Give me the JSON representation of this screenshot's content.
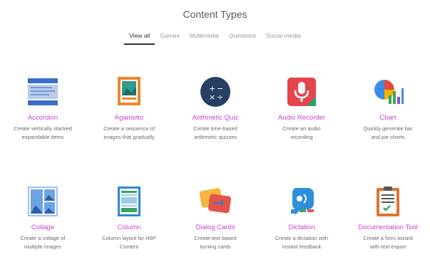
{
  "header": {
    "title": "Content Types"
  },
  "tabs": [
    {
      "label": "View all",
      "active": true
    },
    {
      "label": "Games"
    },
    {
      "label": "Multimedia"
    },
    {
      "label": "Questions"
    },
    {
      "label": "Social media"
    }
  ],
  "cards": [
    {
      "title": "Accordion",
      "desc1": "Create vertically stacked",
      "desc2": "expandable items",
      "icon": "accordion-icon"
    },
    {
      "title": "Agamotto",
      "desc1": "Create a sequence of",
      "desc2": "images that gradually",
      "icon": "agamotto-icon"
    },
    {
      "title": "Arithmetic Quiz",
      "desc1": "Create time-based",
      "desc2": "arithmetic quizzes",
      "icon": "arithmetic-quiz-icon"
    },
    {
      "title": "Audio Recorder",
      "desc1": "Create an audio",
      "desc2": "recording",
      "icon": "microphone-icon"
    },
    {
      "title": "Chart",
      "desc1": "Quickly generate bar",
      "desc2": "and pie charts",
      "icon": "chart-icon"
    },
    {
      "title": "Collage",
      "desc1": "Create a collage of",
      "desc2": "multiple images",
      "icon": "collage-icon"
    },
    {
      "title": "Column",
      "desc1": "Column layout for H5P",
      "desc2": "Content",
      "icon": "column-icon"
    },
    {
      "title": "Dialog Cards",
      "desc1": "Create text-based",
      "desc2": "turning cards",
      "icon": "dialog-cards-icon"
    },
    {
      "title": "Dictation",
      "desc1": "Create a dictation with",
      "desc2": "instant feedback",
      "icon": "dictation-icon"
    },
    {
      "title": "Documentation Tool",
      "desc1": "Create a form wizard",
      "desc2": "with text export",
      "icon": "documentation-tool-icon"
    }
  ],
  "colors": {
    "accent": "#c93fd1"
  }
}
